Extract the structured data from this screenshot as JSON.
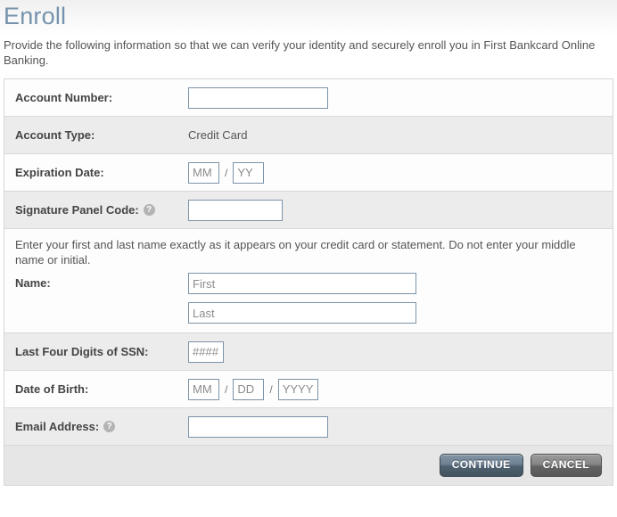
{
  "header": {
    "title": "Enroll",
    "intro": "Provide the following information so that we can verify your identity and securely enroll you in First Bankcard Online Banking."
  },
  "form": {
    "account_number": {
      "label": "Account Number:",
      "value": "",
      "placeholder": ""
    },
    "account_type": {
      "label": "Account Type:",
      "value": "Credit Card"
    },
    "expiration_date": {
      "label": "Expiration Date:",
      "month_placeholder": "MM",
      "year_placeholder": "YY",
      "separator": "/",
      "month_value": "",
      "year_value": ""
    },
    "signature_panel_code": {
      "label": "Signature Panel Code:",
      "help_icon": "help-icon",
      "help_glyph": "?",
      "value": "",
      "placeholder": ""
    },
    "name": {
      "note": "Enter your first and last name exactly as it appears on your credit card or statement. Do not enter your middle name or initial.",
      "label": "Name:",
      "first_placeholder": "First",
      "last_placeholder": "Last",
      "first_value": "",
      "last_value": ""
    },
    "ssn": {
      "label": "Last Four Digits of SSN:",
      "placeholder": "####",
      "value": ""
    },
    "date_of_birth": {
      "label": "Date of Birth:",
      "month_placeholder": "MM",
      "day_placeholder": "DD",
      "year_placeholder": "YYYY",
      "separator": "/",
      "month_value": "",
      "day_value": "",
      "year_value": ""
    },
    "email": {
      "label": "Email Address:",
      "help_icon": "help-icon",
      "help_glyph": "?",
      "value": "",
      "placeholder": ""
    }
  },
  "footer": {
    "continue_label": "CONTINUE",
    "cancel_label": "CANCEL"
  },
  "colors": {
    "title": "#7593ad",
    "body_text": "#555555",
    "label_text": "#444444",
    "input_border": "#7b93a8",
    "row_even_bg": "#ececec",
    "row_odd_bg": "#fdfdfd",
    "footer_bg": "#e6e6e6",
    "continue_button": "#6d8193",
    "cancel_button": "#868686",
    "help_icon_bg": "#b3b3b3"
  }
}
